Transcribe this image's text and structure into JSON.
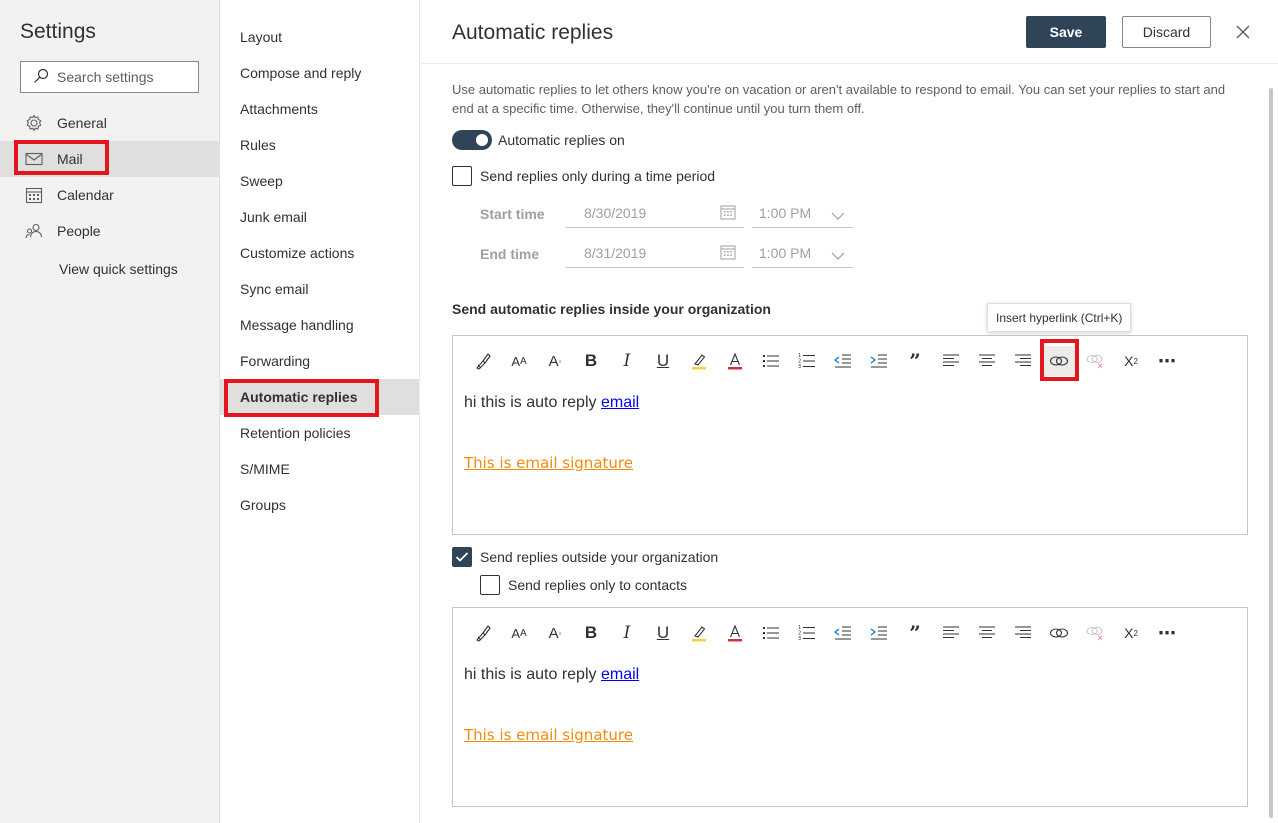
{
  "settings_pane": {
    "title": "Settings",
    "search_placeholder": "Search settings",
    "categories": [
      {
        "label": "General",
        "icon": "gear-icon"
      },
      {
        "label": "Mail",
        "icon": "mail-icon",
        "selected": true
      },
      {
        "label": "Calendar",
        "icon": "calendar-icon"
      },
      {
        "label": "People",
        "icon": "people-icon"
      }
    ],
    "view_quick_settings": "View quick settings"
  },
  "mail_nav": {
    "items": [
      {
        "label": "Layout"
      },
      {
        "label": "Compose and reply"
      },
      {
        "label": "Attachments"
      },
      {
        "label": "Rules"
      },
      {
        "label": "Sweep"
      },
      {
        "label": "Junk email"
      },
      {
        "label": "Customize actions"
      },
      {
        "label": "Sync email"
      },
      {
        "label": "Message handling"
      },
      {
        "label": "Forwarding"
      },
      {
        "label": "Automatic replies",
        "selected": true
      },
      {
        "label": "Retention policies"
      },
      {
        "label": "S/MIME"
      },
      {
        "label": "Groups"
      }
    ]
  },
  "content": {
    "title": "Automatic replies",
    "save_label": "Save",
    "discard_label": "Discard",
    "description": "Use automatic replies to let others know you're on vacation or aren't available to respond to email. You can set your replies to start and end at a specific time. Otherwise, they'll continue until you turn them off.",
    "toggle_label": "Automatic replies on",
    "toggle_on": true,
    "time_period_label": "Send replies only during a time period",
    "time_period_checked": false,
    "start_label": "Start time",
    "start_date": "8/30/2019",
    "start_time": "1:00 PM",
    "end_label": "End time",
    "end_date": "8/31/2019",
    "end_time": "1:00 PM",
    "inside_title": "Send automatic replies inside your organization",
    "tooltip": "Insert hyperlink (Ctrl+K)",
    "inside_message": {
      "text": "hi this is auto reply",
      "link": "email",
      "signature": "This is email signature"
    },
    "outside_label": "Send replies outside your organization",
    "outside_checked": true,
    "contacts_label": "Send replies only to contacts",
    "contacts_checked": false,
    "outside_message": {
      "text": "hi this is auto reply",
      "link": "email",
      "signature": "This is email signature"
    }
  },
  "toolbar_icons": [
    "format-painter-icon",
    "font-size-icon",
    "text-effects-icon",
    "bold-icon",
    "italic-icon",
    "underline-icon",
    "highlight-icon",
    "font-color-icon",
    "bullets-icon",
    "numbering-icon",
    "decrease-indent-icon",
    "increase-indent-icon",
    "quote-icon",
    "align-left-icon",
    "align-center-icon",
    "align-right-icon",
    "insert-link-icon",
    "remove-link-icon",
    "superscript-icon",
    "more-icon"
  ],
  "colors": {
    "accent": "#2f4457",
    "annotation_red": "#e3151e",
    "signature_orange": "#ef8c0d"
  }
}
